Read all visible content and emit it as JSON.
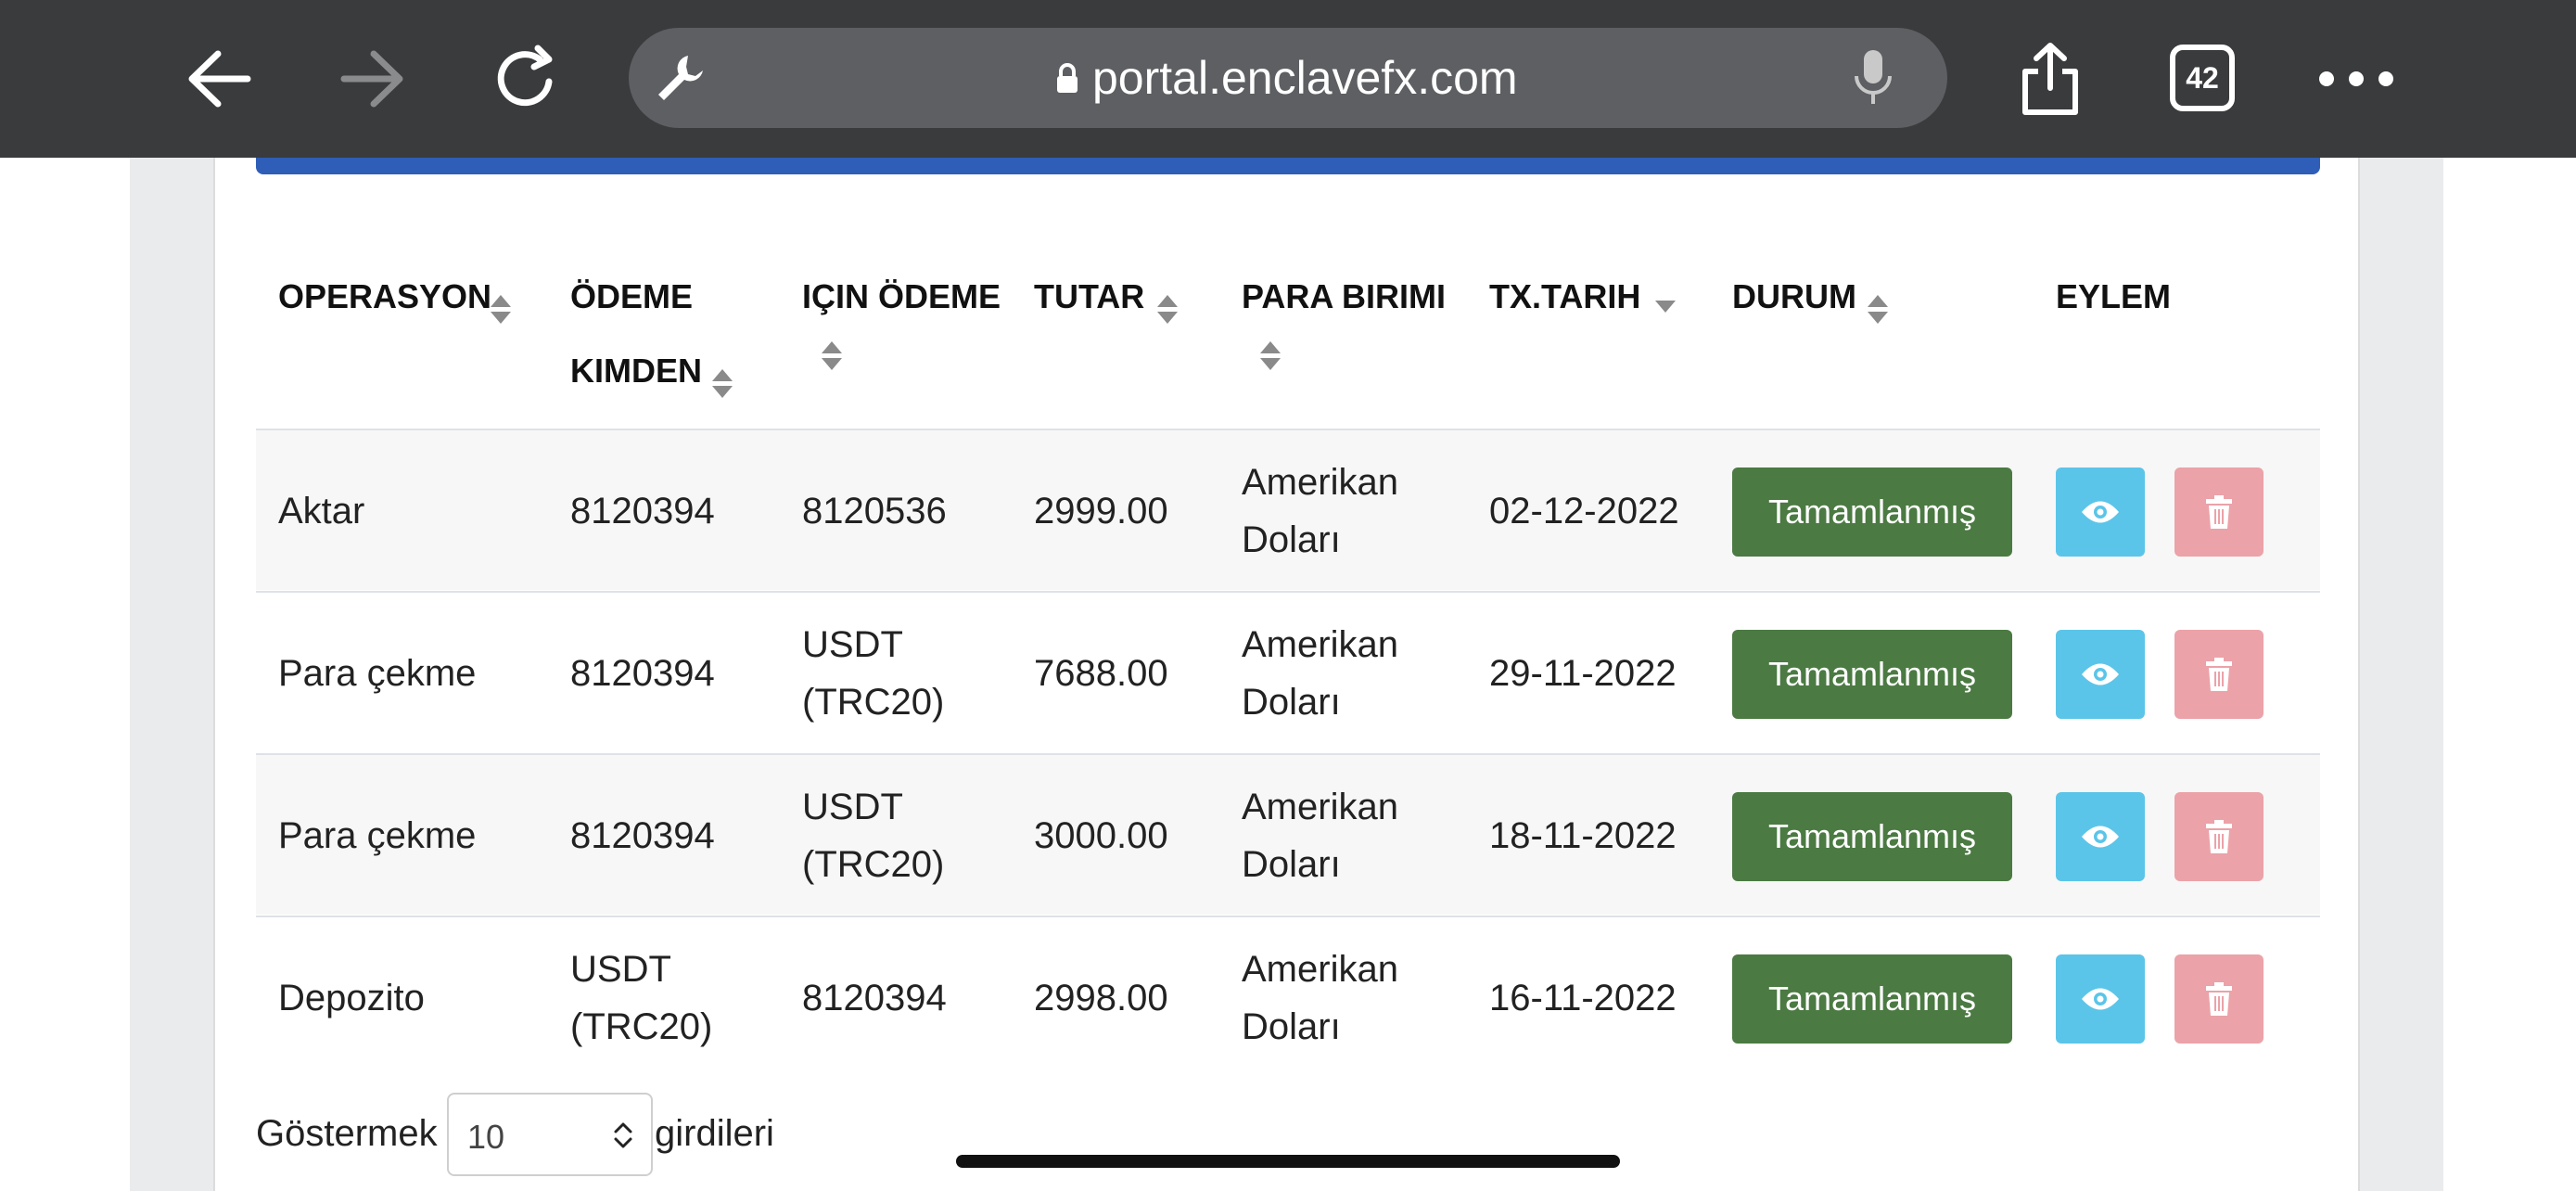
{
  "browser": {
    "url": "portal.enclavefx.com",
    "tab_count": "42",
    "icons": [
      "back-arrow-icon",
      "forward-arrow-icon",
      "reload-icon",
      "wrench-icon",
      "lock-icon",
      "microphone-icon",
      "share-icon",
      "tabs-icon",
      "more-icon"
    ]
  },
  "table": {
    "headers": {
      "operation": "OPERASYON",
      "payment_from_line1": "ÖDEME",
      "payment_from_line2": "KIMDEN",
      "payment_for": "IÇIN ÖDEME",
      "amount": "TUTAR",
      "currency": "PARA BIRIMI",
      "tx_date": "TX.TARIH",
      "status": "DURUM",
      "action": "EYLEM"
    },
    "rows": [
      {
        "operation": "Aktar",
        "from_line1": "8120394",
        "from_line2": "",
        "for_line1": "8120536",
        "for_line2": "",
        "amount": "2999.00",
        "currency_line1": "Amerikan",
        "currency_line2": "Doları",
        "date": "02-12-2022",
        "status": "Tamamlanmış"
      },
      {
        "operation": "Para çekme",
        "from_line1": "8120394",
        "from_line2": "",
        "for_line1": "USDT",
        "for_line2": "(TRC20)",
        "amount": "7688.00",
        "currency_line1": "Amerikan",
        "currency_line2": "Doları",
        "date": "29-11-2022",
        "status": "Tamamlanmış"
      },
      {
        "operation": "Para çekme",
        "from_line1": "8120394",
        "from_line2": "",
        "for_line1": "USDT",
        "for_line2": "(TRC20)",
        "amount": "3000.00",
        "currency_line1": "Amerikan",
        "currency_line2": "Doları",
        "date": "18-11-2022",
        "status": "Tamamlanmış"
      },
      {
        "operation": "Depozito",
        "from_line1": "USDT",
        "from_line2": "(TRC20)",
        "for_line1": "8120394",
        "for_line2": "",
        "amount": "2998.00",
        "currency_line1": "Amerikan",
        "currency_line2": "Doları",
        "date": "16-11-2022",
        "status": "Tamamlanmış"
      }
    ]
  },
  "footer": {
    "show_label": "Göstermek",
    "page_length": "10",
    "entries_label": "girdileri"
  },
  "colors": {
    "toolbar": "#3a3b3d",
    "accent_bar": "#2e5eb7",
    "status_complete": "#4b7a42",
    "view_button": "#5bc5e9",
    "delete_button": "#eba2a8"
  }
}
